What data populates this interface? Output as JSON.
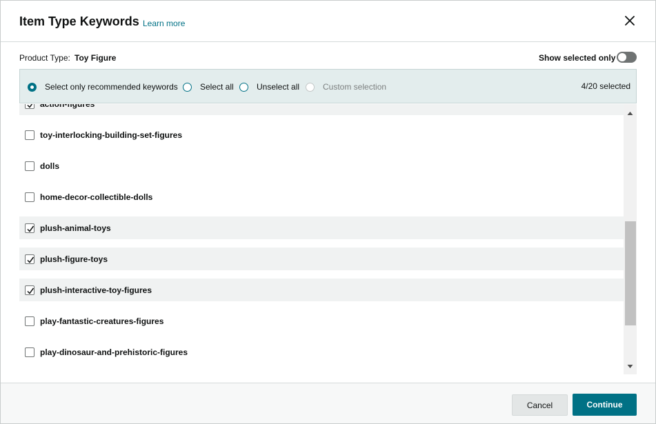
{
  "header": {
    "title": "Item Type Keywords",
    "learn_more": "Learn more"
  },
  "product_type": {
    "label": "Product Type:",
    "value": "Toy Figure"
  },
  "show_selected": {
    "label": "Show selected only",
    "enabled": false
  },
  "selection_options": [
    {
      "label": "Select only recommended keywords",
      "checked": true,
      "disabled": false
    },
    {
      "label": "Select all",
      "checked": false,
      "disabled": false
    },
    {
      "label": "Unselect all",
      "checked": false,
      "disabled": false
    },
    {
      "label": "Custom selection",
      "checked": false,
      "disabled": true
    }
  ],
  "selected_count": "4/20 selected",
  "keywords": [
    {
      "label": "action-figures",
      "checked": true
    },
    {
      "label": "toy-interlocking-building-set-figures",
      "checked": false
    },
    {
      "label": "dolls",
      "checked": false
    },
    {
      "label": "home-decor-collectible-dolls",
      "checked": false
    },
    {
      "label": "plush-animal-toys",
      "checked": true
    },
    {
      "label": "plush-figure-toys",
      "checked": true
    },
    {
      "label": "plush-interactive-toy-figures",
      "checked": true
    },
    {
      "label": "play-fantastic-creatures-figures",
      "checked": false
    },
    {
      "label": "play-dinosaur-and-prehistoric-figures",
      "checked": false
    }
  ],
  "footer": {
    "cancel": "Cancel",
    "continue": "Continue"
  },
  "colors": {
    "accent": "#007185",
    "bar_bg": "#e3eded",
    "selected_row_bg": "#f0f2f2"
  }
}
